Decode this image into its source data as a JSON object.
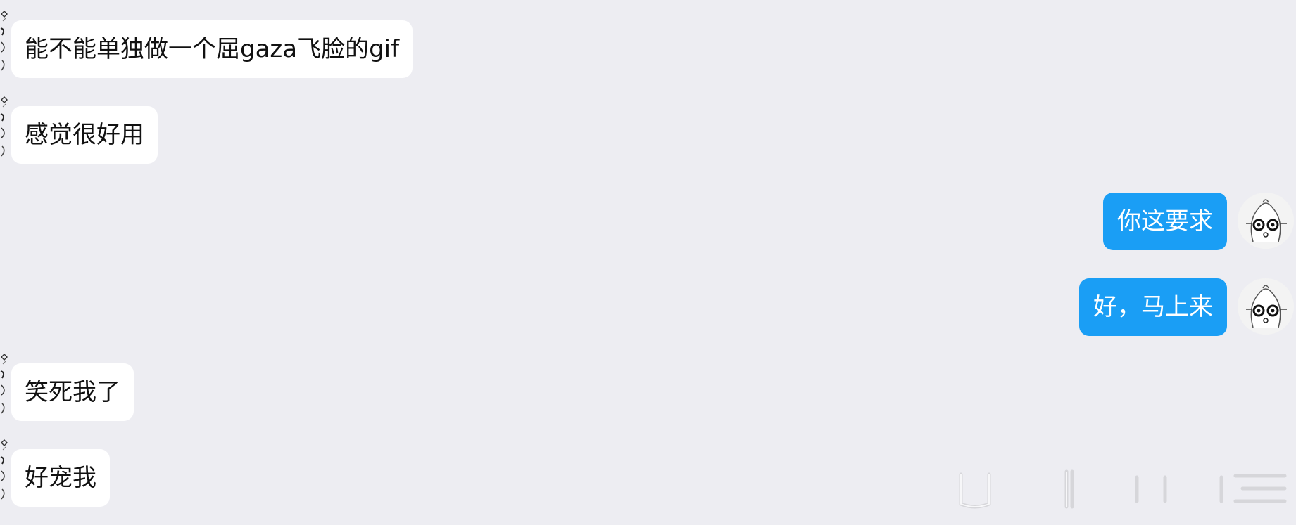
{
  "messages": [
    {
      "side": "in",
      "text": "能不能单独做一个屈gaza飞脸的gif"
    },
    {
      "side": "in",
      "text": "感觉很好用"
    },
    {
      "side": "out",
      "text": "你这要求"
    },
    {
      "side": "out",
      "text": "好，马上来"
    },
    {
      "side": "in",
      "text": "笑死我了"
    },
    {
      "side": "in",
      "text": "好宠我"
    }
  ],
  "colors": {
    "background": "#ededf2",
    "incoming_bubble": "#ffffff",
    "outgoing_bubble": "#1a9ef5"
  },
  "icons": {
    "incoming_avatar": "sketch-avatar-icon",
    "outgoing_avatar": "cartoon-face-avatar-icon"
  }
}
